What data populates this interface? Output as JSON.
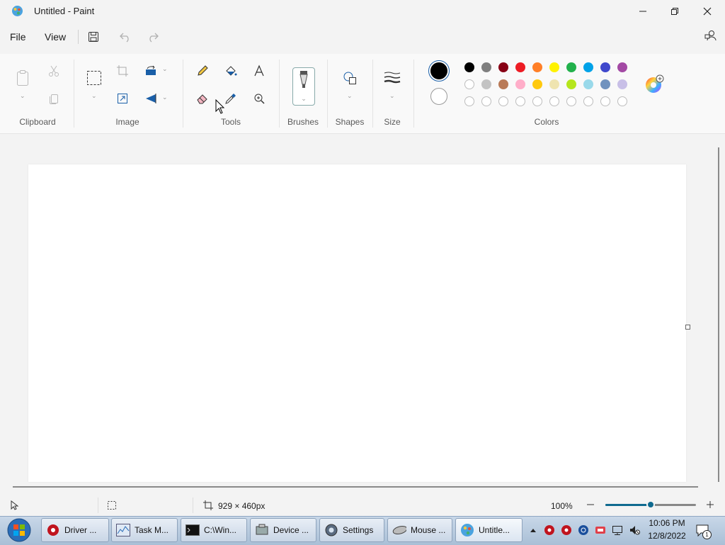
{
  "window": {
    "title": "Untitled - Paint"
  },
  "menu": {
    "file": "File",
    "view": "View"
  },
  "ribbon": {
    "groups": {
      "clipboard": "Clipboard",
      "image": "Image",
      "tools": "Tools",
      "brushes": "Brushes",
      "shapes": "Shapes",
      "size": "Size",
      "colors": "Colors"
    }
  },
  "colors": {
    "primary": "#000000",
    "secondary": "#ffffff",
    "palette_row1": [
      "#000000",
      "#7f7f7f",
      "#880015",
      "#ed1c24",
      "#ff7f27",
      "#fff200",
      "#22b14c",
      "#00a2e8",
      "#3f48cc",
      "#a349a4"
    ],
    "palette_row2": [
      "#ffffff",
      "#c3c3c3",
      "#b97a57",
      "#ffaec9",
      "#ffc90e",
      "#efe4b0",
      "#b5e61d",
      "#99d9ea",
      "#7092be",
      "#c8bfe7"
    ],
    "palette_row3": [
      "",
      "",
      "",
      "",
      "",
      "",
      "",
      "",
      "",
      ""
    ]
  },
  "status": {
    "canvas_size": "929 × 460px",
    "zoom": "100%",
    "zoom_fraction": 0.5
  },
  "taskbar": {
    "items": [
      {
        "label": "Driver ...",
        "icon": "driver-icon"
      },
      {
        "label": "Task M...",
        "icon": "task-manager-icon"
      },
      {
        "label": "C:\\Win...",
        "icon": "console-icon"
      },
      {
        "label": "Device ...",
        "icon": "device-manager-icon"
      },
      {
        "label": "Settings",
        "icon": "settings-gear-icon"
      },
      {
        "label": "Mouse ...",
        "icon": "mouse-icon"
      },
      {
        "label": "Untitle...",
        "icon": "paint-icon"
      }
    ],
    "time": "10:06 PM",
    "date": "12/8/2022",
    "notification_count": "1"
  }
}
